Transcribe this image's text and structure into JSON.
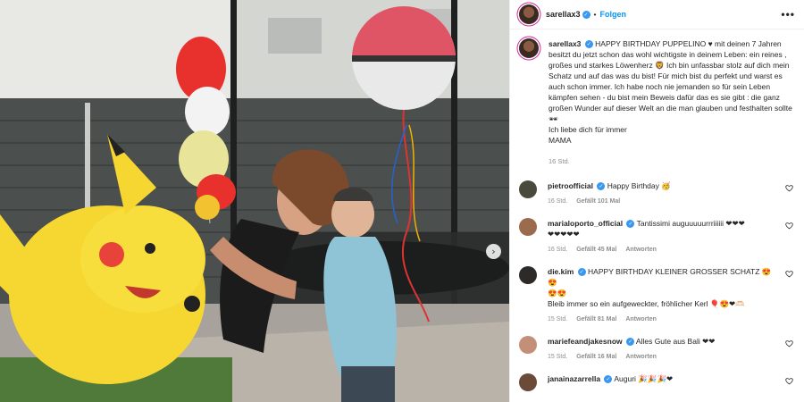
{
  "post": {
    "username": "sarellax3",
    "follow_label": "Folgen",
    "more_label": "•••",
    "dot": "•"
  },
  "caption": {
    "username": "sarellax3",
    "text": "HAPPY BIRTHDAY PUPPELINO ♥ mit deinen 7 Jahren besitzt du jetzt schon das wohl wichtigste in deinem Leben: ein reines , großes und starkes Löwenherz 🦁 Ich bin unfassbar stolz auf dich mein Schatz und auf das was du bist! Für mich bist du perfekt und warst es auch schon immer. Ich habe noch nie jemanden so für sein Leben kämpfen sehen - du bist mein Beweis dafür das es sie gibt : die ganz großen Wunder auf dieser Welt an die man glauben und festhalten sollte 🕶",
    "line2": "Ich liebe dich für immer",
    "line3": "MAMA",
    "time": "16 Std."
  },
  "comments": [
    {
      "username": "pietroofficial",
      "text": "Happy Birthday 🥳",
      "time": "16 Std.",
      "likes": "Gefällt 101 Mal",
      "reply": "",
      "avatar_color": "#4a4a3c"
    },
    {
      "username": "marialoporto_official",
      "text": "Tantissimi auguuuuurrriiiiii ❤❤❤",
      "text2": "❤❤❤❤❤",
      "time": "16 Std.",
      "likes": "Gefällt 45 Mal",
      "reply": "Antworten",
      "avatar_color": "#9c6b4e"
    },
    {
      "username": "die.kim",
      "text": "HAPPY BIRTHDAY KLEINER GROSSER SCHATZ 😍😍",
      "text2": "😍😍",
      "text3": "Bleib immer so ein aufgeweckter, fröhlicher Kerl 🎈😍❤🫶🏻",
      "time": "15 Std.",
      "likes": "Gefällt 81 Mal",
      "reply": "Antworten",
      "avatar_color": "#2d2a28"
    },
    {
      "username": "mariefeandjakesnow",
      "text": "Alles Gute aus Bali ❤❤",
      "time": "15 Std.",
      "likes": "Gefällt 16 Mal",
      "reply": "Antworten",
      "avatar_color": "#c48f78"
    },
    {
      "username": "janainazarrella",
      "text": "Auguri 🎉🎉🎉❤",
      "avatar_color": "#6b4a3a"
    }
  ],
  "photo": {
    "next_icon": "›"
  },
  "colors": {
    "link_blue": "#0095f6",
    "verified_blue": "#3897f0",
    "muted": "#8e8e8e"
  }
}
